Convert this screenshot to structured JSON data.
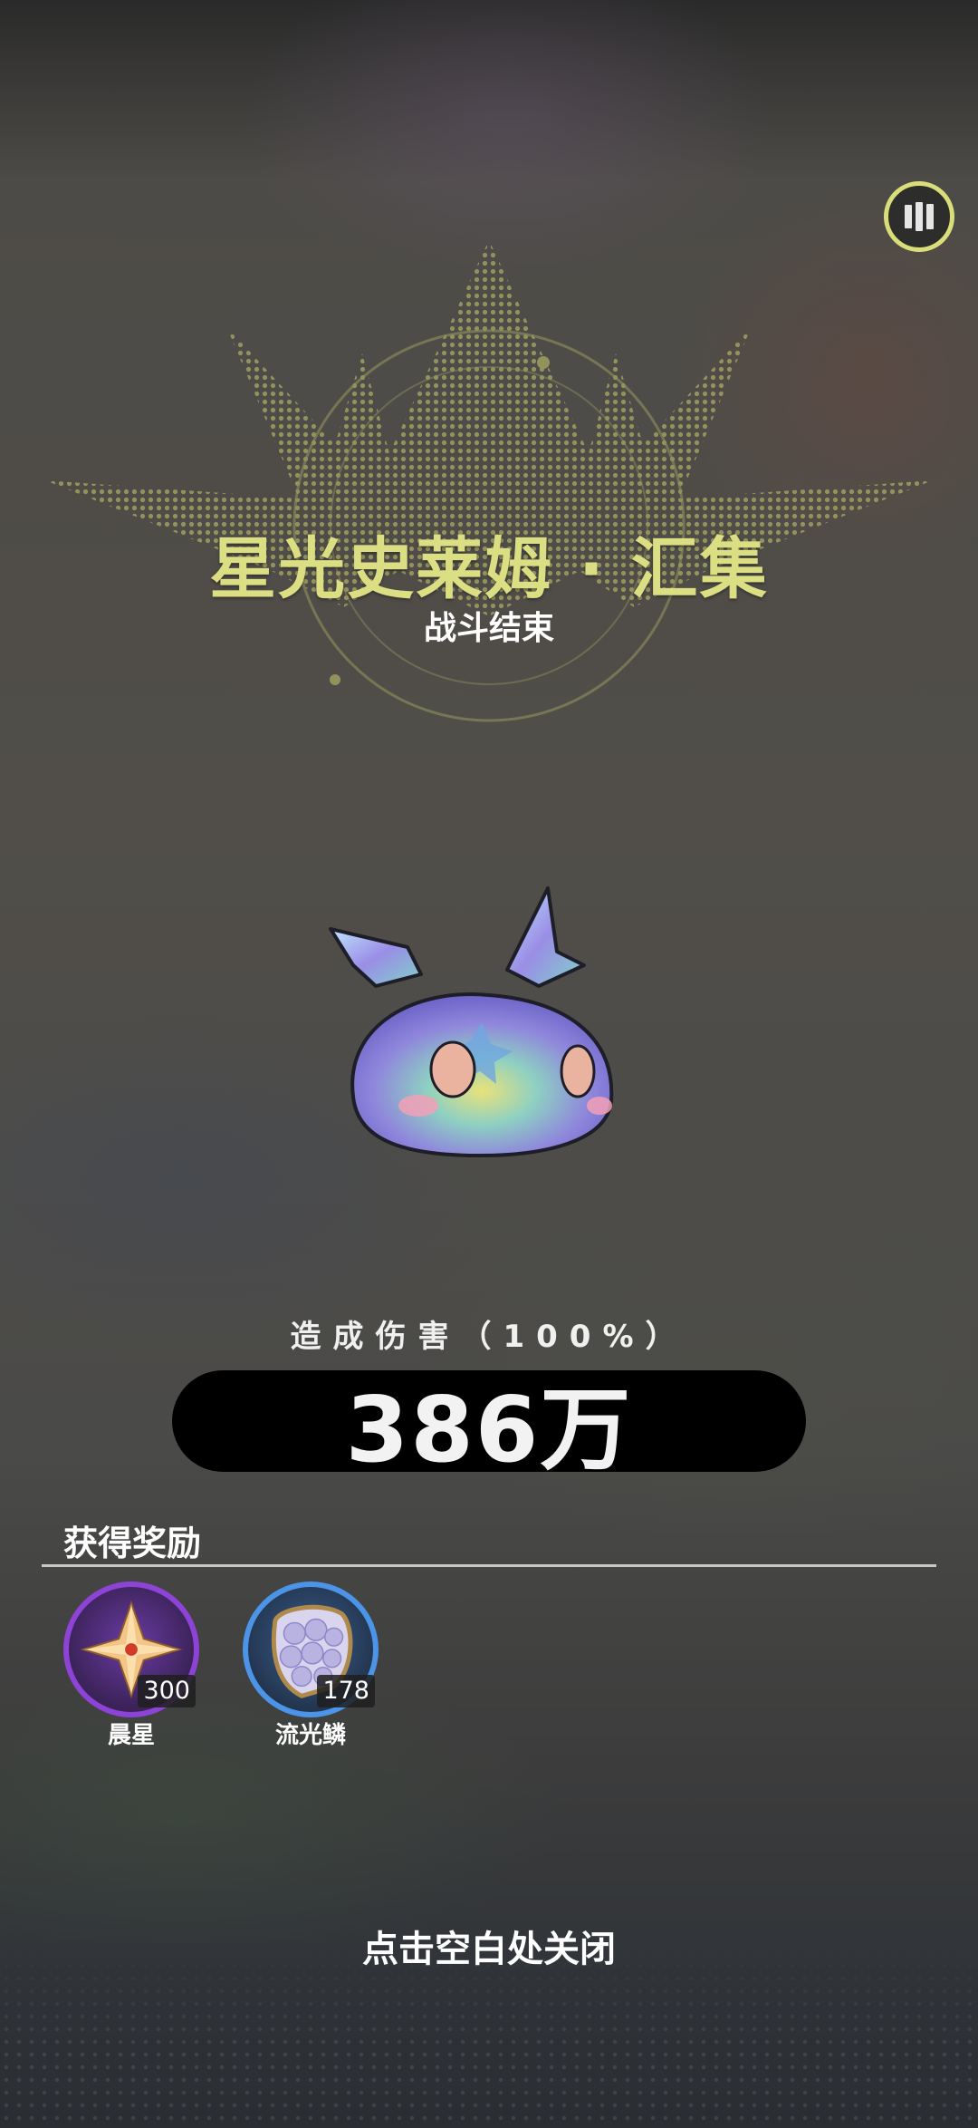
{
  "header": {
    "title": "星光史莱姆 · 汇集",
    "subtitle": "战斗结束",
    "stats_icon": "bar-chart-icon"
  },
  "damage": {
    "label": "造成伤害（100%）",
    "value": "386万"
  },
  "rewards": {
    "title": "获得奖励",
    "items": [
      {
        "name": "晨星",
        "count": "300",
        "icon": "star-crystal-icon",
        "ring_color": "#8c43d6"
      },
      {
        "name": "流光鳞",
        "count": "178",
        "icon": "scale-icon",
        "ring_color": "#4c94e8"
      }
    ]
  },
  "footer": {
    "close_hint": "点击空白处关闭"
  },
  "colors": {
    "title": "#dbde82",
    "crown": "#c8cc6e",
    "damage_pill": "#000000"
  }
}
